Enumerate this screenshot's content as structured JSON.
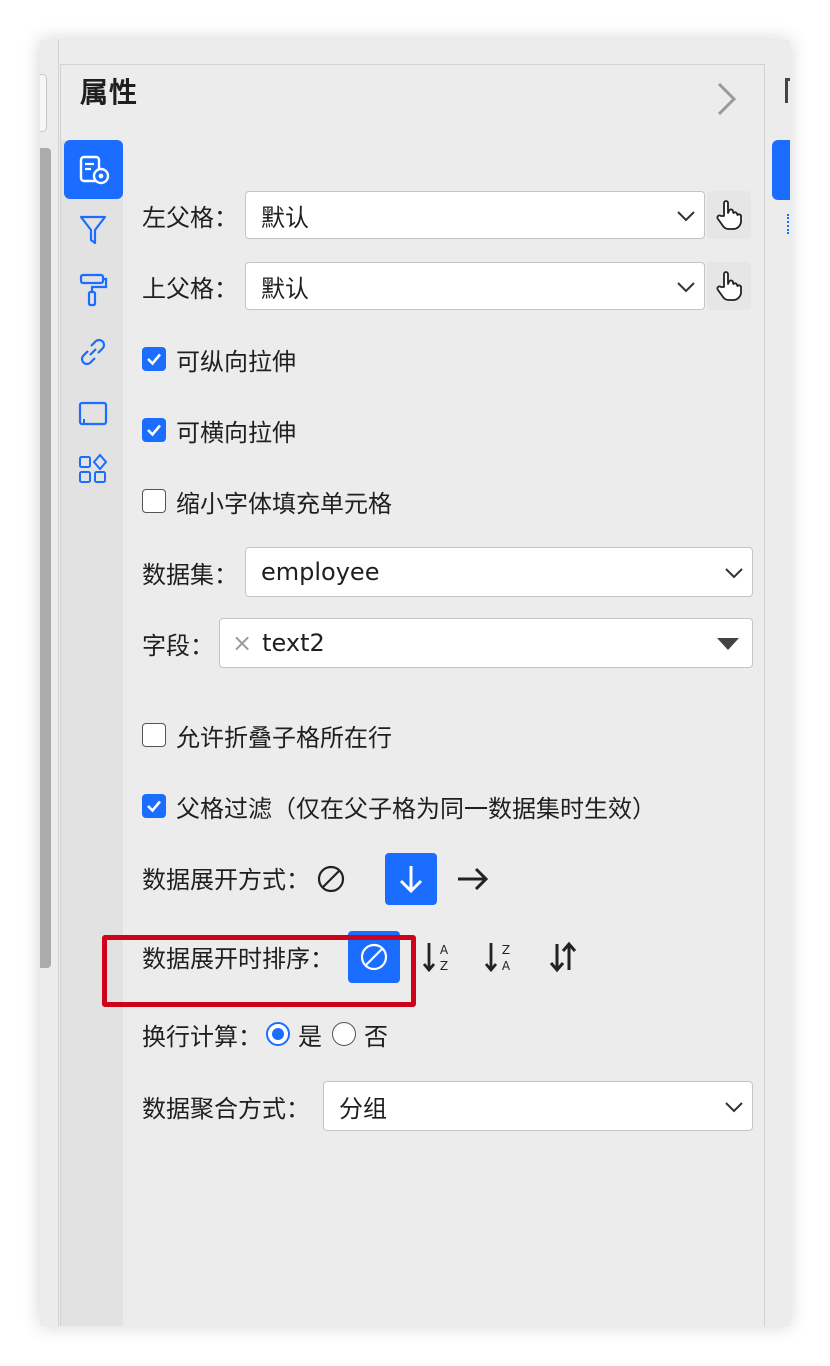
{
  "panel": {
    "title": "属性"
  },
  "rail": {
    "icons": [
      "cell-props-icon",
      "filter-icon",
      "paint-roller-icon",
      "link-icon",
      "frame-icon",
      "widgets-icon"
    ],
    "active_index": 0
  },
  "fields": {
    "left_parent": {
      "label": "左父格：",
      "value": "默认"
    },
    "top_parent": {
      "label": "上父格：",
      "value": "默认"
    },
    "vertical_stretch": {
      "label": "可纵向拉伸",
      "checked": true
    },
    "horizontal_stretch": {
      "label": "可横向拉伸",
      "checked": true
    },
    "shrink_font": {
      "label": "缩小字体填充单元格",
      "checked": false
    },
    "dataset": {
      "label": "数据集：",
      "value": "employee"
    },
    "field": {
      "label": "字段：",
      "tag": "text2",
      "remove_glyph": "×"
    },
    "allow_fold": {
      "label": "允许折叠子格所在行",
      "checked": false
    },
    "parent_filter": {
      "label": "父格过滤（仅在父子格为同一数据集时生效）",
      "checked": true
    },
    "expand_mode": {
      "label": "数据展开方式：",
      "options": [
        "none",
        "vertical",
        "horizontal"
      ],
      "selected": "vertical"
    },
    "expand_sort": {
      "label": "数据展开时排序：",
      "options": [
        "none",
        "asc",
        "desc",
        "custom"
      ],
      "selected": "none"
    },
    "wrap_calc": {
      "label": "换行计算：",
      "yes": "是",
      "no": "否",
      "selected": "yes"
    },
    "aggregation": {
      "label": "数据聚合方式：",
      "value": "分组"
    }
  },
  "colors": {
    "accent": "#1a6dff",
    "highlight": "#d0021b",
    "panel_bg": "#ececec"
  }
}
